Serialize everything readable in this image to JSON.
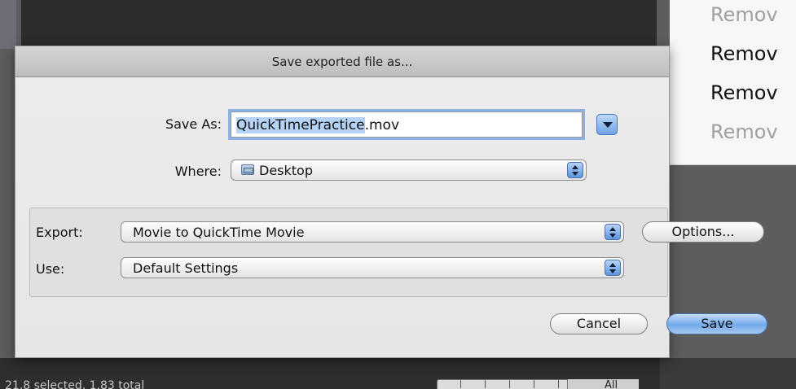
{
  "background": {
    "status_text": "21.8 selected, 1.83 total",
    "timeline_label": "All"
  },
  "side_list": {
    "items": [
      {
        "label": "Remov",
        "style": "faded"
      },
      {
        "label": "Remov",
        "style": "bold"
      },
      {
        "label": "Remov",
        "style": "bold"
      },
      {
        "label": "Remov",
        "style": "faded"
      }
    ]
  },
  "dialog": {
    "title": "Save exported file as...",
    "save_as_label": "Save As:",
    "filename_selected": "QuickTimePractice",
    "filename_ext": ".mov",
    "where_label": "Where:",
    "where_value": "Desktop",
    "export_label": "Export:",
    "export_value": "Movie to QuickTime Movie",
    "options_button": "Options...",
    "use_label": "Use:",
    "use_value": "Default Settings",
    "cancel_button": "Cancel",
    "save_button": "Save"
  },
  "colors": {
    "accent": "#73a9e9",
    "selection": "#b5d3f6",
    "focus_ring": "#8bb2e6"
  },
  "icons": {
    "disclosure": "triangle-down-icon",
    "folder": "folder-icon",
    "popup_arrows": "updown-arrows-icon"
  }
}
